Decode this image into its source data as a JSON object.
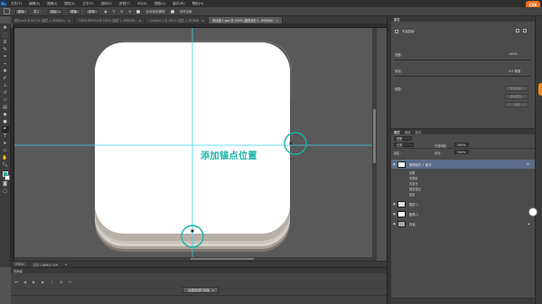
{
  "app": {
    "logo": "Ps",
    "menu": [
      "文件(F)",
      "编辑(E)",
      "图像(I)",
      "图层(L)",
      "文字(Y)",
      "选择(S)",
      "滤镜(T)",
      "3D(D)",
      "视图(V)",
      "窗口(W)",
      "帮助(H)"
    ],
    "orange_badge_line1": "CS6",
    "orange_badge_line2": "中文"
  },
  "options_bar": {
    "mode_label": "路径",
    "make_label": "建立：",
    "selection_btn": "选区...",
    "mask_btn": "蒙版",
    "shape_btn": "形状",
    "auto_add_delete": "自动添加/删除",
    "align_edges": "对齐边缘"
  },
  "tabs": [
    {
      "label": "现代.psd @ 66.7% (图层 1, RGB/8#)",
      "active": false
    },
    {
      "label": "TIMISHEN.Psd @ 100% (图层 1, RGB/8#)",
      "active": false
    },
    {
      "label": "Untitled-1 @ 100% (图层 1, RGB/8)",
      "active": false
    },
    {
      "label": "未标题-1.psd @ 200% (圆角矩形 1, RGB/8#)",
      "active": true
    }
  ],
  "canvas": {
    "annotation": "添加锚点位置",
    "annotation_color": "#19b3a5",
    "guide_color": "#35d6e6"
  },
  "status": {
    "zoom": "200%",
    "doc_info": "文档:2.86M/4.34M"
  },
  "timeline": {
    "title": "时间轴",
    "create_button": "创建视频时间轴"
  },
  "properties": {
    "header": "属性",
    "mode_label": "矢量蒙版",
    "density_label": "浓度：",
    "density_value": "100%",
    "feather_label": "羽化：",
    "feather_value": "0.0 像素",
    "refine_label": "调整：",
    "buttons": [
      "蒙版边缘...",
      "颜色范围...",
      "反相"
    ]
  },
  "layers": {
    "tabs": [
      "图层",
      "通道",
      "路径"
    ],
    "filter_label": "类型",
    "blend_mode": "正常",
    "opacity_label": "不透明度：",
    "opacity_value": "100%",
    "lock_label": "锁定：",
    "fill_label": "填充：",
    "fill_value": "100%",
    "rows": [
      {
        "name": "圆角矩形 1 副本",
        "fx": "fx",
        "selected": true,
        "thumb": "white"
      },
      {
        "name": "效果",
        "sub": true
      },
      {
        "name": "内阴影",
        "sub": true
      },
      {
        "name": "内发光",
        "sub": true
      },
      {
        "name": "渐变叠加",
        "sub": true
      },
      {
        "name": "投影",
        "sub": true
      },
      {
        "name": "图层 1",
        "selected": false,
        "thumb": "check"
      },
      {
        "name": "圆角 1",
        "selected": false,
        "thumb": "white"
      },
      {
        "name": "背景",
        "selected": false,
        "thumb": "gray",
        "locked": true
      }
    ]
  }
}
